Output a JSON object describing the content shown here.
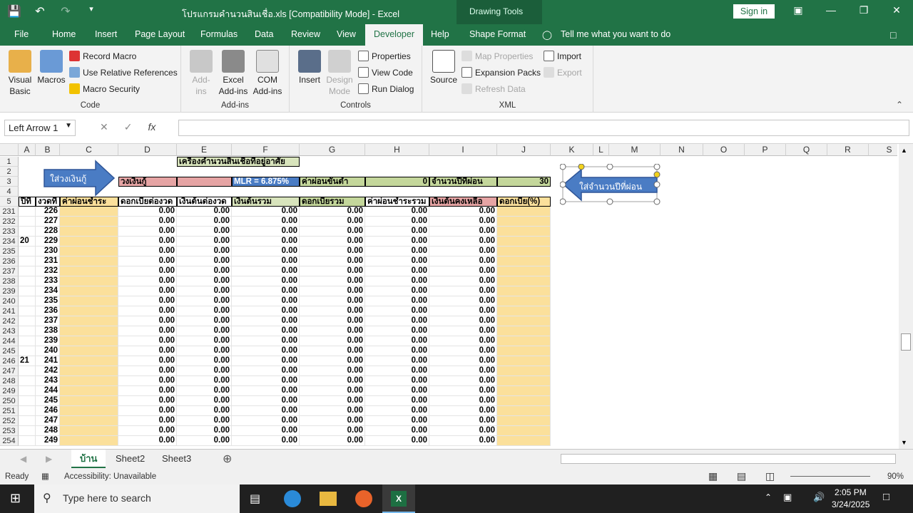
{
  "window": {
    "title": "โปรแกรมคำนวนสินเชื่อ.xls  [Compatibility Mode]  -  Excel",
    "drawing_tools": "Drawing Tools",
    "sign_in": "Sign in"
  },
  "tabs": [
    "File",
    "Home",
    "Insert",
    "Page Layout",
    "Formulas",
    "Data",
    "Review",
    "View",
    "Developer",
    "Help",
    "Shape Format"
  ],
  "tell_me": "Tell me what you want to do",
  "ribbon": {
    "code": {
      "visual_basic": "Visual Basic",
      "macros": "Macros",
      "record_macro": "Record Macro",
      "relative_refs": "Use Relative References",
      "macro_security": "Macro Security",
      "label": "Code"
    },
    "addins": {
      "addins": "Add-ins",
      "excel_addins": "Excel Add-ins",
      "com_addins": "COM Add-ins",
      "label": "Add-ins"
    },
    "controls": {
      "insert": "Insert",
      "design_mode": "Design Mode",
      "properties": "Properties",
      "view_code": "View Code",
      "run_dialog": "Run Dialog",
      "label": "Controls"
    },
    "xml": {
      "source": "Source",
      "map_properties": "Map Properties",
      "expansion_packs": "Expansion Packs",
      "refresh_data": "Refresh Data",
      "import": "Import",
      "export": "Export",
      "label": "XML"
    }
  },
  "formula_bar": {
    "name_box": "Left Arrow 1",
    "fx": "fx",
    "value": ""
  },
  "columns": [
    "A",
    "B",
    "C",
    "D",
    "E",
    "F",
    "G",
    "H",
    "I",
    "J",
    "K",
    "L",
    "M",
    "N",
    "O",
    "P",
    "Q",
    "R",
    "S"
  ],
  "header_rows": {
    "row1_title": "เครื่องคำนวนสินเชื่อที่อยู่อาศัย",
    "loan_label": "วงเงินกู้",
    "mlr": "MLR = 6.875%",
    "min_payment_label": "ค่าผ่อนขั้นต่ำ",
    "min_payment_value": "0",
    "years_label": "จำนวนปีที่ผ่อน",
    "years_value": "30",
    "col_headers": [
      "ปีที่",
      "งวดที่",
      "ค่าผ่อนชำระ",
      "ดอกเบี้ยต่องวด",
      "เงินต้นต่องวด",
      "เงินต้นรวม",
      "ดอกเบี้ยรวม",
      "ค่าผ่อนชำระรวม",
      "เงินต้นคงเหลือ",
      "ดอกเบี้ย(%)"
    ]
  },
  "shapes": {
    "right_arrow_text": "ใส่วงเงินกู้",
    "left_arrow_text": "ใส่จำนวนปีที่ผ่อน"
  },
  "data_rows": [
    {
      "row": "231",
      "year": "",
      "period": "226"
    },
    {
      "row": "232",
      "year": "",
      "period": "227"
    },
    {
      "row": "233",
      "year": "",
      "period": "228"
    },
    {
      "row": "234",
      "year": "20",
      "period": "229"
    },
    {
      "row": "235",
      "year": "",
      "period": "230"
    },
    {
      "row": "236",
      "year": "",
      "period": "231"
    },
    {
      "row": "237",
      "year": "",
      "period": "232"
    },
    {
      "row": "238",
      "year": "",
      "period": "233"
    },
    {
      "row": "239",
      "year": "",
      "period": "234"
    },
    {
      "row": "240",
      "year": "",
      "period": "235"
    },
    {
      "row": "241",
      "year": "",
      "period": "236"
    },
    {
      "row": "242",
      "year": "",
      "period": "237"
    },
    {
      "row": "243",
      "year": "",
      "period": "238"
    },
    {
      "row": "244",
      "year": "",
      "period": "239"
    },
    {
      "row": "245",
      "year": "",
      "period": "240"
    },
    {
      "row": "246",
      "year": "21",
      "period": "241"
    },
    {
      "row": "247",
      "year": "",
      "period": "242"
    },
    {
      "row": "248",
      "year": "",
      "period": "243"
    },
    {
      "row": "249",
      "year": "",
      "period": "244"
    },
    {
      "row": "250",
      "year": "",
      "period": "245"
    },
    {
      "row": "251",
      "year": "",
      "period": "246"
    },
    {
      "row": "252",
      "year": "",
      "period": "247"
    },
    {
      "row": "253",
      "year": "",
      "period": "248"
    },
    {
      "row": "254",
      "year": "",
      "period": "249"
    }
  ],
  "zero_value": "0.00",
  "top_row_numbers": [
    "1",
    "2",
    "3",
    "4",
    "5"
  ],
  "sheets": [
    "บ้าน",
    "Sheet2",
    "Sheet3"
  ],
  "status": {
    "ready": "Ready",
    "accessibility": "Accessibility: Unavailable",
    "zoom": "90%"
  },
  "taskbar": {
    "search_placeholder": "Type here to search",
    "time": "2:05 PM",
    "date": "3/24/2025"
  },
  "colors": {
    "green": "#217346",
    "pink": "#e6a4a4",
    "blue": "#4a7cc4",
    "yellow": "#fbe09b",
    "olive": "#c4d79b",
    "header_green": "#d8e4bc"
  }
}
